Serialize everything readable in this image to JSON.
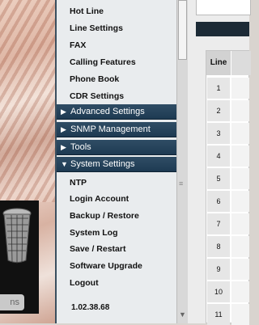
{
  "sidebar": {
    "items_top": [
      "Hot Line",
      "Line Settings",
      "FAX",
      "Calling Features",
      "Phone Book",
      "CDR Settings"
    ],
    "sections": [
      {
        "label": "Advanced Settings",
        "state": "collapsed"
      },
      {
        "label": "SNMP Management",
        "state": "collapsed"
      },
      {
        "label": "Tools",
        "state": "collapsed"
      },
      {
        "label": "System Settings",
        "state": "expanded"
      }
    ],
    "arrows": {
      "collapsed": "▶",
      "expanded": "▼"
    },
    "sub_items": [
      "NTP",
      "Login Account",
      "Backup / Restore",
      "System Log",
      "Save / Restart",
      "Software Upgrade",
      "Logout"
    ],
    "version": "1.02.38.68"
  },
  "desktop": {
    "taskbar_button": "ns"
  },
  "table": {
    "header": "Line",
    "rows": [
      "1",
      "2",
      "3",
      "4",
      "5",
      "6",
      "7",
      "8",
      "9",
      "10",
      "11"
    ]
  },
  "colors": {
    "section_bg": "#1e3a52",
    "sidebar_bg": "#e9ecee"
  }
}
